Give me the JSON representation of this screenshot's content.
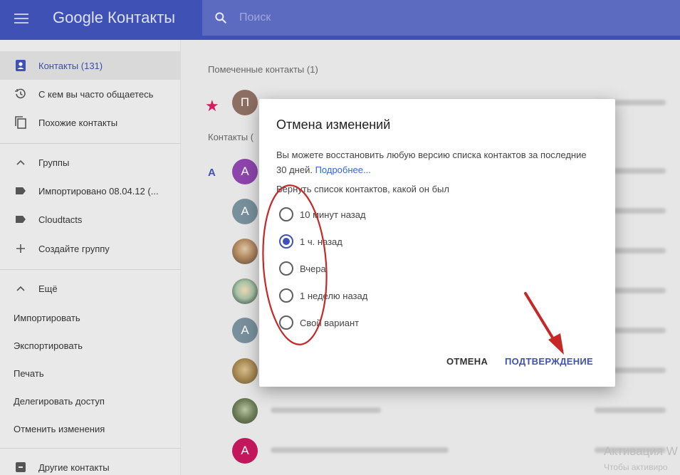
{
  "header": {
    "title": "Google Контакты",
    "search_placeholder": "Поиск"
  },
  "sidebar": {
    "items": [
      {
        "label": "Контакты (131)",
        "icon": "contacts-icon"
      },
      {
        "label": "С кем вы часто общаетесь",
        "icon": "history-icon"
      },
      {
        "label": "Похожие контакты",
        "icon": "copy-icon"
      },
      {
        "label": "Группы",
        "icon": "chevron-up-icon"
      },
      {
        "label": "Импортировано 08.04.12 (...",
        "icon": "label-icon"
      },
      {
        "label": "Cloudtacts",
        "icon": "label-icon"
      },
      {
        "label": "Создайте группу",
        "icon": "plus-icon"
      },
      {
        "label": "Ещё",
        "icon": "chevron-up-icon"
      },
      {
        "label": "Импортировать"
      },
      {
        "label": "Экспортировать"
      },
      {
        "label": "Печать"
      },
      {
        "label": "Делегировать доступ"
      },
      {
        "label": "Отменить изменения"
      },
      {
        "label": "Другие контакты",
        "icon": "archive-icon"
      }
    ]
  },
  "main": {
    "starred_label": "Помеченные контакты (1)",
    "contacts_label": "Контакты (",
    "letter": "A",
    "starred_avatar": "П",
    "avatar_letter": "A"
  },
  "dialog": {
    "title": "Отмена изменений",
    "description": "Вы можете восстановить любую версию списка контактов за последние 30 дней.",
    "link": "Подробнее...",
    "subtitle": "Вернуть список контактов, какой он был",
    "options": [
      {
        "label": "10 минут назад",
        "checked": false
      },
      {
        "label": "1 ч. назад",
        "checked": true
      },
      {
        "label": "Вчера",
        "checked": false
      },
      {
        "label": "1 неделю назад",
        "checked": false
      },
      {
        "label": "Свой вариант",
        "checked": false
      }
    ],
    "cancel": "ОТМЕНА",
    "confirm": "ПОДТВЕРЖДЕНИЕ"
  },
  "watermark": {
    "line1": "Активация W",
    "line2": "Чтобы активиро"
  },
  "colors": {
    "header": "#3f51b5",
    "search": "#5c6bc0",
    "accent": "#3f51b5",
    "star": "#d81b60",
    "annotation": "#c62828"
  }
}
